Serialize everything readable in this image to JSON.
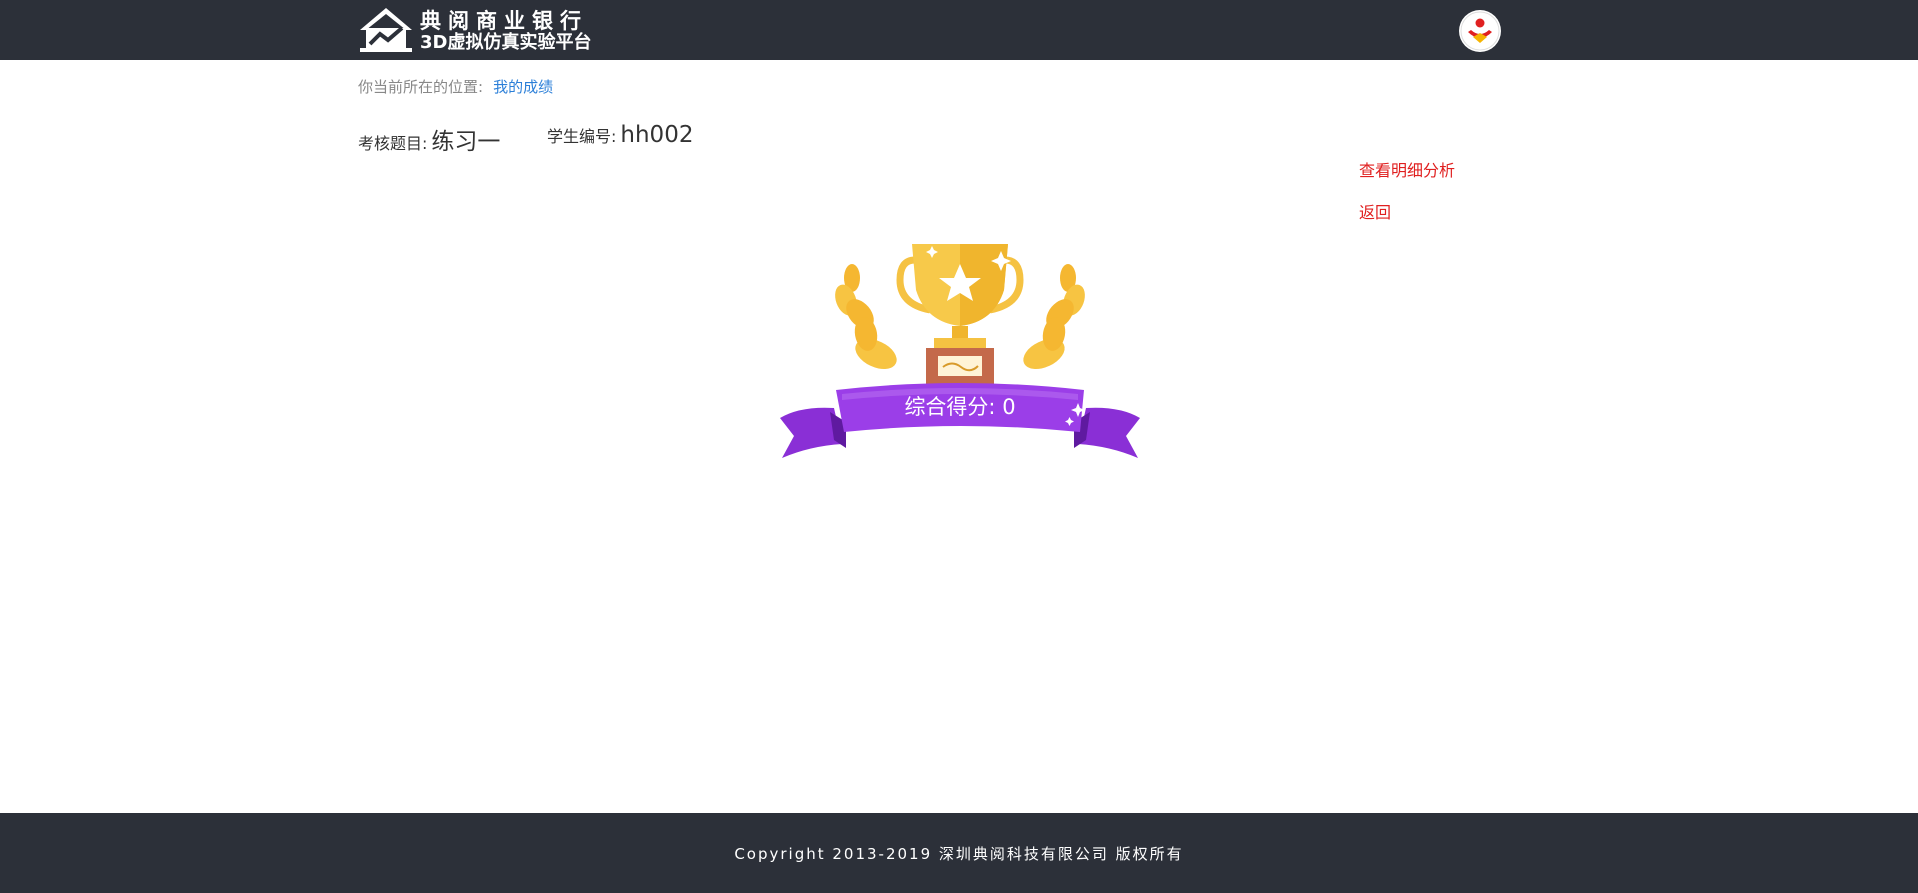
{
  "header": {
    "logo_line1": "典阅商业银行",
    "logo_line2": "3D虚拟仿真实验平台",
    "avatar_icon": "user-avatar-icon"
  },
  "breadcrumb": {
    "prefix": "你当前所在的位置:",
    "current": "我的成绩"
  },
  "exam": {
    "topic_label": "考核题目:",
    "topic_value": "练习一",
    "student_label": "学生编号:",
    "student_value": "hh002"
  },
  "actions": {
    "detail_analysis": "查看明细分析",
    "back": "返回"
  },
  "result": {
    "score_text": "综合得分:  0",
    "score": 0
  },
  "footer": {
    "copyright": "Copyright  2013-2019  深圳典阅科技有限公司 版权所有"
  },
  "colors": {
    "header_bg": "#2c3039",
    "link_blue": "#2b7fd8",
    "action_red": "#e02020",
    "ribbon_purple": "#9b3ee8",
    "trophy_gold": "#f5c242"
  }
}
